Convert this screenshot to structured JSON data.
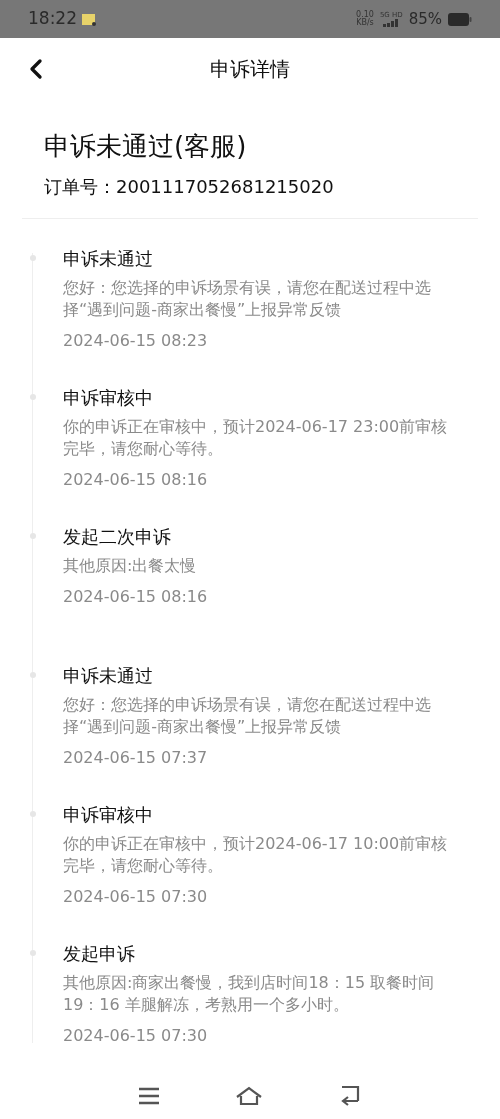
{
  "status_bar": {
    "time": "18:22",
    "net_speed": "0.10",
    "net_unit": "KB/s",
    "network": "5G HD",
    "battery": "85%"
  },
  "header": {
    "title": "申诉详情"
  },
  "summary": {
    "title": "申诉未通过(客服)",
    "order_label": "订单号：",
    "order_number": "2001117052681215020"
  },
  "timeline": [
    {
      "title": "申诉未通过",
      "text": "您好：您选择的申诉场景有误，请您在配送过程中选择“遇到问题-商家出餐慢”上报异常反馈",
      "time": "2024-06-15 08:23"
    },
    {
      "title": "申诉审核中",
      "text": "你的申诉正在审核中，预计2024-06-17 23:00前审核完毕，请您耐心等待。",
      "time": "2024-06-15 08:16"
    },
    {
      "title": "发起二次申诉",
      "text": "其他原因:出餐太慢",
      "time": "2024-06-15 08:16"
    },
    {
      "title": "申诉未通过",
      "text": "您好：您选择的申诉场景有误，请您在配送过程中选择“遇到问题-商家出餐慢”上报异常反馈",
      "time": "2024-06-15 07:37"
    },
    {
      "title": "申诉审核中",
      "text": "你的申诉正在审核中，预计2024-06-17 10:00前审核完毕，请您耐心等待。",
      "time": "2024-06-15 07:30"
    },
    {
      "title": "发起申诉",
      "text": "其他原因:商家出餐慢，我到店时间18：15 取餐时间19：16  羊腿解冻，考熟用一个多小时。",
      "time": "2024-06-15 07:30"
    }
  ]
}
